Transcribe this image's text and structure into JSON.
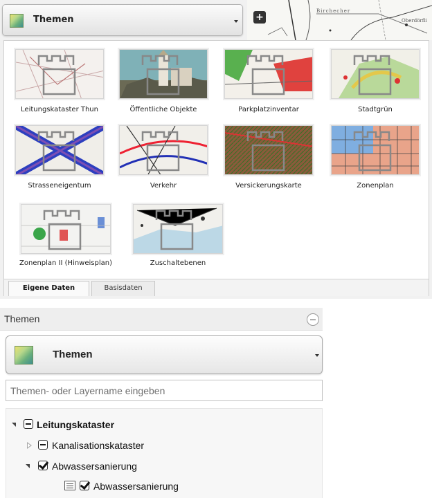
{
  "top": {
    "theme_select_label": "Themen",
    "mini_map": {
      "add_symbol": "+",
      "label_1": "Birchecher",
      "label_2": "Oberdörfli"
    },
    "thumbnails": [
      {
        "label": "Leitungskataster Thun"
      },
      {
        "label": "Öffentliche Objekte"
      },
      {
        "label": "Parkplatzinventar"
      },
      {
        "label": "Stadtgrün"
      },
      {
        "label": "Strasseneigentum"
      },
      {
        "label": "Verkehr"
      },
      {
        "label": "Versickerungskarte"
      },
      {
        "label": "Zonenplan"
      },
      {
        "label": "Zonenplan II (Hinweisplan)"
      },
      {
        "label": "Zuschaltebenen"
      }
    ],
    "tabs": [
      {
        "label": "Eigene Daten",
        "active": true
      },
      {
        "label": "Basisdaten",
        "active": false
      }
    ]
  },
  "lower": {
    "panel_title": "Themen",
    "theme_select_label": "Themen",
    "search_placeholder": "Themen- oder Layername eingeben",
    "tree": [
      {
        "label": "Leitungskataster",
        "bold": true,
        "expanded": true,
        "state": "partial"
      },
      {
        "label": "Kanalisationskataster",
        "expanded": false,
        "state": "partial"
      },
      {
        "label": "Abwassersanierung",
        "expanded": true,
        "state": "checked"
      },
      {
        "label": "Abwassersanierung",
        "leaf": true,
        "state": "checked"
      }
    ]
  },
  "colors": {
    "panel_bg": "#f1f1f1",
    "tab_active_bg": "#fafafa",
    "tree_bg": "#f7f7f7"
  }
}
